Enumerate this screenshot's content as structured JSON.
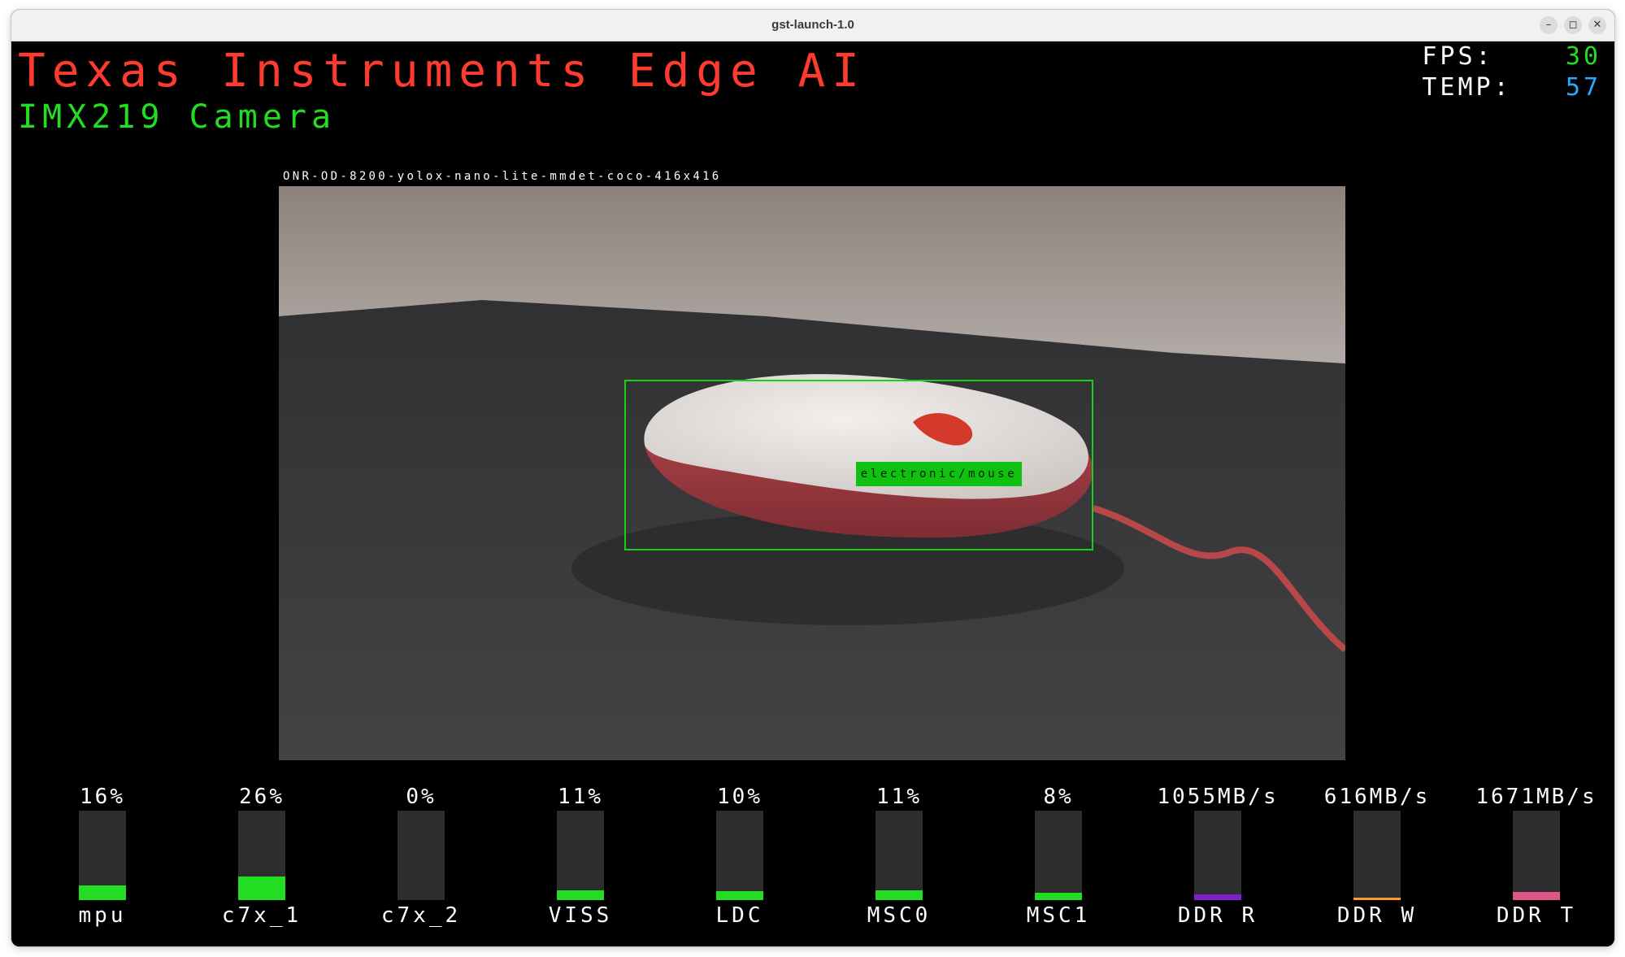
{
  "window": {
    "title": "gst-launch-1.0"
  },
  "overlay": {
    "title": "Texas Instruments Edge AI",
    "subtitle": "IMX219 Camera",
    "fps_label": "FPS:",
    "fps_value": "30",
    "temp_label": "TEMP:",
    "temp_value": "57",
    "model_name": "ONR-OD-8200-yolox-nano-lite-mmdet-coco-416x416",
    "detection_label": "electronic/mouse"
  },
  "colors": {
    "title": "#ff3b2f",
    "subtitle": "#22dd22",
    "fps": "#22dd22",
    "temp": "#2aa7ff",
    "bbox": "#18d018"
  },
  "meters": [
    {
      "value": "16%",
      "name": "mpu",
      "fill_pct": 16,
      "color": "#22dd22"
    },
    {
      "value": "26%",
      "name": "c7x_1",
      "fill_pct": 26,
      "color": "#22dd22"
    },
    {
      "value": "0%",
      "name": "c7x_2",
      "fill_pct": 0,
      "color": "#22dd22"
    },
    {
      "value": "11%",
      "name": "VISS",
      "fill_pct": 11,
      "color": "#22dd22"
    },
    {
      "value": "10%",
      "name": "LDC",
      "fill_pct": 10,
      "color": "#22dd22"
    },
    {
      "value": "11%",
      "name": "MSC0",
      "fill_pct": 11,
      "color": "#22dd22"
    },
    {
      "value": "8%",
      "name": "MSC1",
      "fill_pct": 8,
      "color": "#22dd22"
    },
    {
      "value": "1055MB/s",
      "name": "DDR R",
      "fill_pct": 6,
      "color": "#7b22cc"
    },
    {
      "value": "616MB/s",
      "name": "DDR W",
      "fill_pct": 3,
      "color": "#ff9a2a"
    },
    {
      "value": "1671MB/s",
      "name": "DDR T",
      "fill_pct": 9,
      "color": "#e0558a"
    }
  ]
}
